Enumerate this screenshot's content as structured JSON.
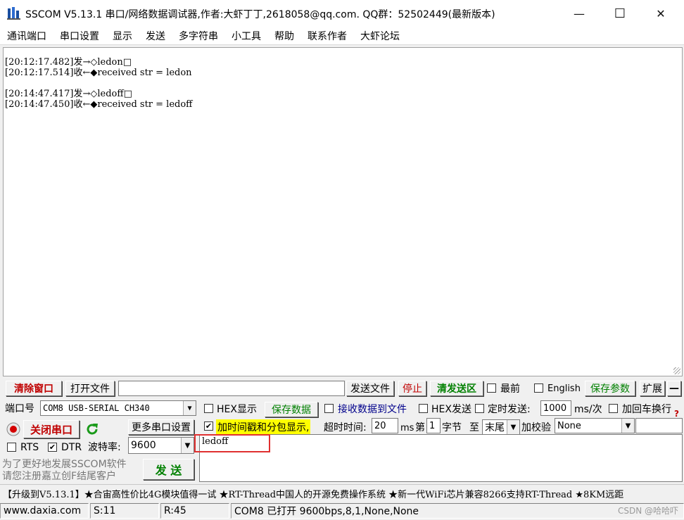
{
  "window": {
    "title": "SSCOM V5.13.1 串口/网络数据调试器,作者:大虾丁丁,2618058@qq.com. QQ群：52502449(最新版本)",
    "minimize": "—",
    "maximize": "☐",
    "close": "✕"
  },
  "menu": [
    "通讯端口",
    "串口设置",
    "显示",
    "发送",
    "多字符串",
    "小工具",
    "帮助",
    "联系作者",
    "大虾论坛"
  ],
  "log": {
    "lines": [
      "[20:12:17.482]发→◇ledon□",
      "[20:12:17.514]收←◆received str = ledon",
      "",
      "[20:14:47.417]发→◇ledoff□",
      "[20:14:47.450]收←◆received str = ledoff"
    ]
  },
  "toolbar": {
    "clear_window": "清除窗口",
    "open_file": "打开文件",
    "file_path": "",
    "send_file": "发送文件",
    "stop": "停止",
    "clear_send": "清发送区",
    "topmost": "最前",
    "english": "English",
    "save_params": "保存参数",
    "expand": "扩展",
    "collapse": "—"
  },
  "port": {
    "label": "端口号",
    "value": "COM8 USB-SERIAL CH340",
    "close_port": "关闭串口",
    "more_settings": "更多串口设置",
    "rts": "RTS",
    "dtr": "DTR",
    "baud_label": "波特率:",
    "baud": "9600"
  },
  "options": {
    "hex_display": "HEX显示",
    "save_data": "保存数据",
    "recv_to_file": "接收数据到文件",
    "hex_send": "HEX发送",
    "timed_send": "定时发送:",
    "interval": "1000",
    "interval_unit": "ms/次",
    "add_crlf": "加回车换行",
    "timestamp": "加时间戳和分包显示,",
    "timeout_label": "超时时间:",
    "timeout": "20",
    "timeout_unit": "ms",
    "nth_label": "第",
    "nth": "1",
    "byte_label": "字节",
    "to_label": "至",
    "end": "末尾",
    "checksum_label": "加校验",
    "checksum": "None",
    "help_mark": "?"
  },
  "send": {
    "text": "ledoff",
    "button": "发  送",
    "promo": [
      "为了更好地发展SSCOM软件",
      "请您注册嘉立创F结尾客户"
    ]
  },
  "ticker": "【升级到V5.13.1】★合宙高性价比4G模块值得一试 ★RT-Thread中国人的开源免费操作系统 ★新一代WiFi芯片兼容8266支持RT-Thread ★8KM远距",
  "status": {
    "site": "www.daxia.com",
    "sent": "S:11",
    "recv": "R:45",
    "port_state": "COM8 已打开  9600bps,8,1,None,None",
    "watermark": "CSDN @哈哈吓"
  },
  "colors": {
    "red_text": "#c00000",
    "green_text": "#008000",
    "highlight": "#ffff00",
    "send_box_border": "#e03030"
  }
}
